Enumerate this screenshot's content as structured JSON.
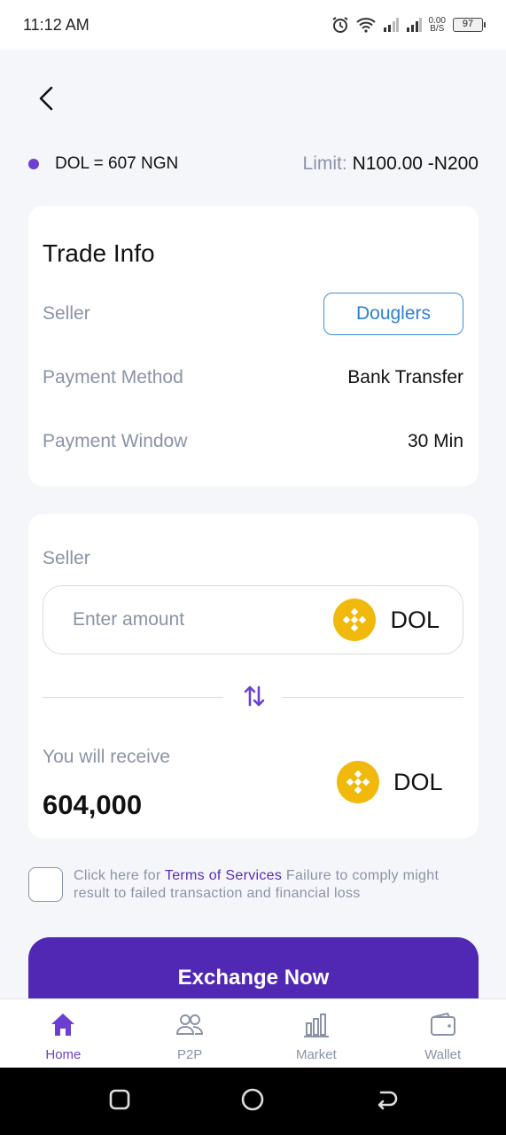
{
  "status_bar": {
    "time": "11:12 AM",
    "net_speed_value": "0.00",
    "net_speed_unit": "B/S",
    "battery": "97"
  },
  "rate": {
    "text": "DOL = 607 NGN",
    "limit_label": "Limit:",
    "limit_value": "N100.00 -N200"
  },
  "trade_info": {
    "title": "Trade Info",
    "seller_label": "Seller",
    "seller_name": "Douglers",
    "payment_method_label": "Payment Method",
    "payment_method_value": "Bank Transfer",
    "payment_window_label": "Payment Window",
    "payment_window_value": "30 Min"
  },
  "exchange": {
    "seller_label": "Seller",
    "amount_placeholder": "Enter amount",
    "amount_currency": "DOL",
    "receive_label": "You will receive",
    "receive_value": "604,000",
    "receive_currency": "DOL"
  },
  "terms": {
    "prefix": "Click here for ",
    "link": "Terms of Services",
    "suffix": " Failure to comply might result to failed transaction and financial loss"
  },
  "exchange_button": "Exchange Now",
  "bottom_nav": [
    {
      "label": "Home",
      "icon": "home-icon",
      "active": true
    },
    {
      "label": "P2P",
      "icon": "users-icon",
      "active": false
    },
    {
      "label": "Market",
      "icon": "bar-chart-icon",
      "active": false
    },
    {
      "label": "Wallet",
      "icon": "wallet-icon",
      "active": false
    }
  ],
  "colors": {
    "accent": "#6c3fd1",
    "button": "#5128b3",
    "coin": "#f0b90b",
    "chip_border": "#3d8fd6",
    "muted_text": "#8a93a6"
  }
}
